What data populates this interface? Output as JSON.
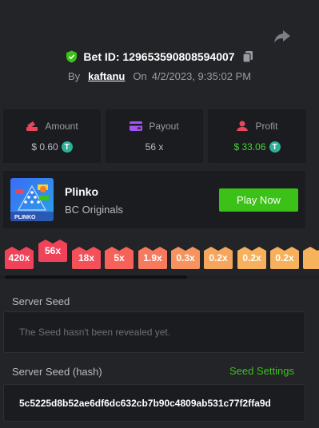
{
  "bet": {
    "id_label": "Bet ID: 129653590808594007",
    "by": "By",
    "user": "kaftanu",
    "on": "On",
    "datetime": "4/2/2023, 9:35:02 PM"
  },
  "stats": [
    {
      "label": "Amount",
      "value": "$ 0.60",
      "coin": "T",
      "icon": "amount-icon"
    },
    {
      "label": "Payout",
      "value": "56 x",
      "icon": "payout-icon"
    },
    {
      "label": "Profit",
      "value": "$ 33.06",
      "coin": "T",
      "icon": "profit-icon"
    }
  ],
  "game": {
    "name": "Plinko",
    "provider": "BC Originals",
    "thumb_text": "PLINKO",
    "play_label": "Play Now"
  },
  "multipliers": [
    "420x",
    "56x",
    "18x",
    "5x",
    "1.9x",
    "0.3x",
    "0.2x",
    "0.2x",
    "0.2x"
  ],
  "seeds": {
    "server_seed_label": "Server Seed",
    "server_seed_value": "The Seed hasn't been revealed yet.",
    "hash_label": "Server Seed (hash)",
    "settings_label": "Seed Settings",
    "hash_value": "5c5225d8b52ae6df6dc632cb7b90c4809ab531c77f2ffa9d"
  },
  "colors": {
    "accent_green": "#3bc117",
    "profit_green": "#49d13c",
    "background": "#232428",
    "panel": "#1b1c20"
  }
}
